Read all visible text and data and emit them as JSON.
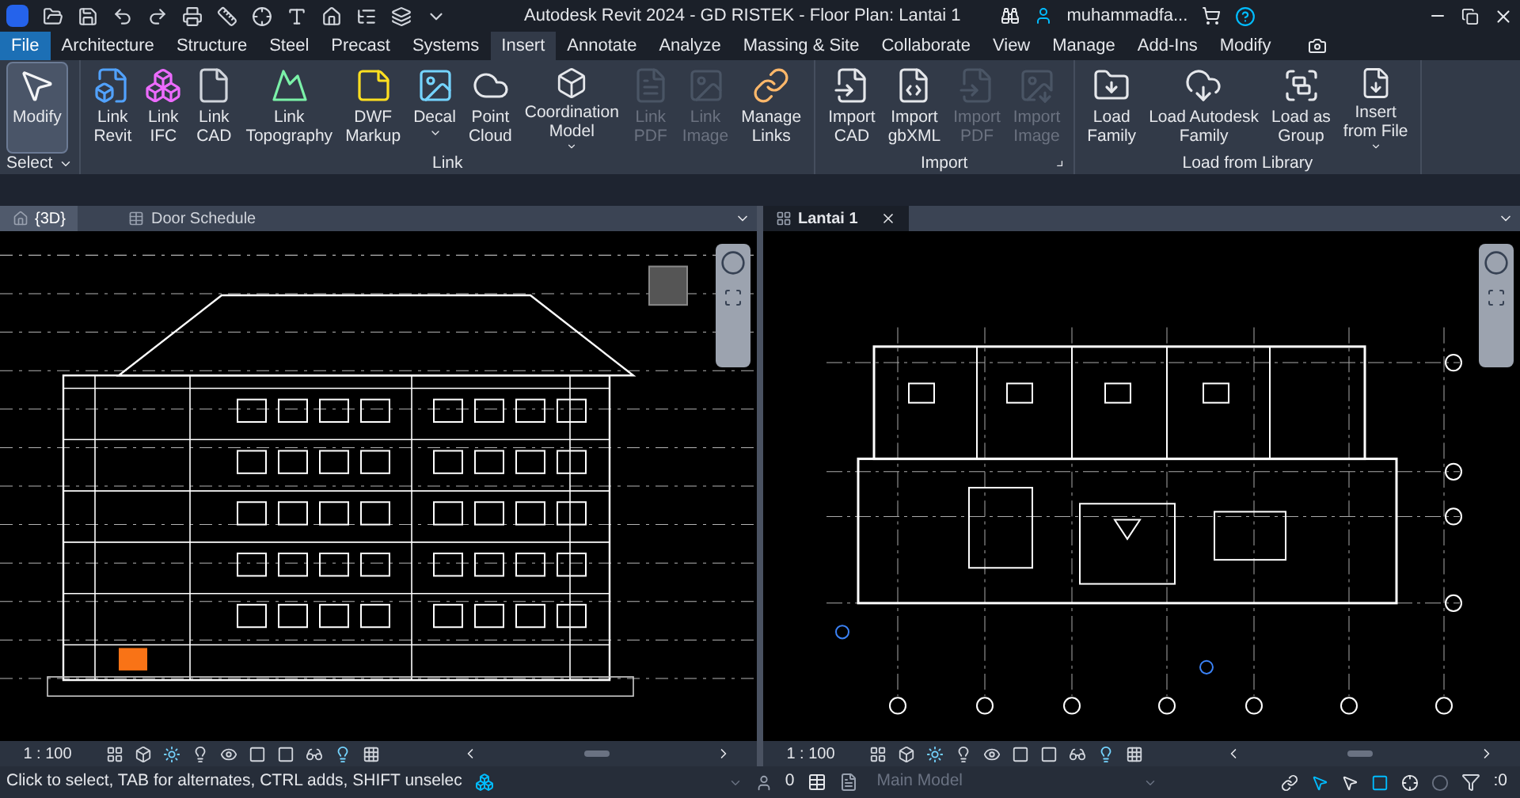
{
  "title_bar": {
    "title": "Autodesk Revit 2024 - GD RISTEK - Floor Plan: Lantai 1",
    "user": "muhammadfa..."
  },
  "menu_tabs": [
    {
      "label": "File",
      "kind": "file",
      "selected": false
    },
    {
      "label": "Architecture",
      "kind": "tab",
      "selected": false
    },
    {
      "label": "Structure",
      "kind": "tab",
      "selected": false
    },
    {
      "label": "Steel",
      "kind": "tab",
      "selected": false
    },
    {
      "label": "Precast",
      "kind": "tab",
      "selected": false
    },
    {
      "label": "Systems",
      "kind": "tab",
      "selected": false
    },
    {
      "label": "Insert",
      "kind": "tab",
      "selected": true
    },
    {
      "label": "Annotate",
      "kind": "tab",
      "selected": false
    },
    {
      "label": "Analyze",
      "kind": "tab",
      "selected": false
    },
    {
      "label": "Massing & Site",
      "kind": "tab",
      "selected": false
    },
    {
      "label": "Collaborate",
      "kind": "tab",
      "selected": false
    },
    {
      "label": "View",
      "kind": "tab",
      "selected": false
    },
    {
      "label": "Manage",
      "kind": "tab",
      "selected": false
    },
    {
      "label": "Add-Ins",
      "kind": "tab",
      "selected": false
    },
    {
      "label": "Modify",
      "kind": "tab",
      "selected": false
    }
  ],
  "ribbon": [
    {
      "title": "Select",
      "has_menu": true,
      "launcher": false,
      "tools": [
        {
          "label": "Modify",
          "disabled": false,
          "selected": true,
          "has_menu": false
        }
      ]
    },
    {
      "title": "Link",
      "has_menu": false,
      "launcher": false,
      "tools": [
        {
          "label": "Link\nRevit",
          "disabled": false,
          "selected": false,
          "has_menu": false
        },
        {
          "label": "Link\nIFC",
          "disabled": false,
          "selected": false,
          "has_menu": false
        },
        {
          "label": "Link\nCAD",
          "disabled": false,
          "selected": false,
          "has_menu": false
        },
        {
          "label": "Link\nTopography",
          "disabled": false,
          "selected": false,
          "has_menu": false
        },
        {
          "label": "DWF\nMarkup",
          "disabled": false,
          "selected": false,
          "has_menu": false
        },
        {
          "label": "Decal",
          "disabled": false,
          "selected": false,
          "has_menu": true
        },
        {
          "label": "Point\nCloud",
          "disabled": false,
          "selected": false,
          "has_menu": false
        },
        {
          "label": "Coordination\nModel",
          "disabled": false,
          "selected": false,
          "has_menu": true
        },
        {
          "label": "Link\nPDF",
          "disabled": true,
          "selected": false,
          "has_menu": false
        },
        {
          "label": "Link\nImage",
          "disabled": true,
          "selected": false,
          "has_menu": false
        },
        {
          "label": "Manage\nLinks",
          "disabled": false,
          "selected": false,
          "has_menu": false
        }
      ]
    },
    {
      "title": "Import",
      "has_menu": false,
      "launcher": true,
      "tools": [
        {
          "label": "Import\nCAD",
          "disabled": false,
          "selected": false,
          "has_menu": false
        },
        {
          "label": "Import\ngbXML",
          "disabled": false,
          "selected": false,
          "has_menu": false
        },
        {
          "label": "Import\nPDF",
          "disabled": true,
          "selected": false,
          "has_menu": false
        },
        {
          "label": "Import\nImage",
          "disabled": true,
          "selected": false,
          "has_menu": false
        }
      ]
    },
    {
      "title": "Load from Library",
      "has_menu": false,
      "launcher": false,
      "tools": [
        {
          "label": "Load\nFamily",
          "disabled": false,
          "selected": false,
          "has_menu": false
        },
        {
          "label": "Load Autodesk\nFamily",
          "disabled": false,
          "selected": false,
          "has_menu": false
        },
        {
          "label": "Load as\nGroup",
          "disabled": false,
          "selected": false,
          "has_menu": false
        },
        {
          "label": "Insert\nfrom File",
          "disabled": false,
          "selected": false,
          "has_menu": true
        }
      ]
    }
  ],
  "panes": [
    {
      "kind": "elevation",
      "tabs": [
        {
          "label": "{3D}",
          "kind": "model",
          "selected": true,
          "closable": false
        },
        {
          "label": "Door Schedule",
          "kind": "schedule",
          "selected": false,
          "closable": false
        }
      ],
      "scale": "1 : 100"
    },
    {
      "kind": "plan",
      "tabs": [
        {
          "label": "Lantai 1",
          "kind": "plan",
          "selected": true,
          "closable": true
        }
      ],
      "scale": "1 : 100"
    }
  ],
  "status_bar": {
    "message": "Click to select, TAB for alternates, CTRL adds, SHIFT unselec",
    "editable_count": "0",
    "model": "Main Model",
    "filter_count": ":0"
  }
}
